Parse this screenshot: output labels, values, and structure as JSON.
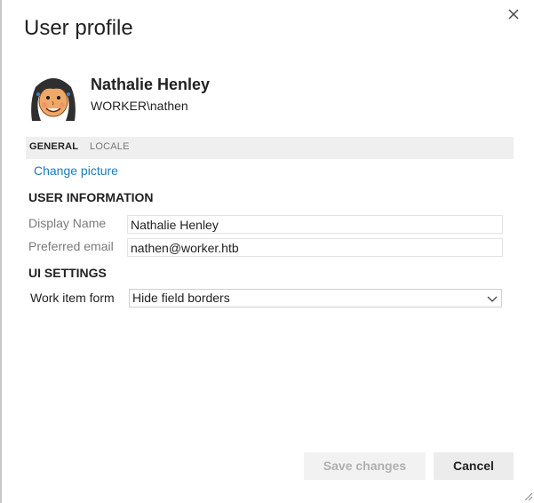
{
  "dialog": {
    "title": "User profile",
    "close_icon": "close-icon"
  },
  "user": {
    "name": "Nathalie Henley",
    "account": "WORKER\\nathen",
    "avatar_icon": "avatar-icon"
  },
  "tabs": [
    {
      "label": "GENERAL",
      "active": true
    },
    {
      "label": "LOCALE",
      "active": false
    }
  ],
  "change_picture_label": "Change picture",
  "user_information": {
    "heading": "USER INFORMATION",
    "display_name_label": "Display Name",
    "display_name_value": "Nathalie Henley",
    "email_label": "Preferred email",
    "email_value": "nathen@worker.htb"
  },
  "ui_settings": {
    "heading": "UI SETTINGS",
    "work_item_form_label": "Work item form",
    "work_item_form_value": "Hide field borders"
  },
  "buttons": {
    "save_label": "Save changes",
    "save_enabled": false,
    "cancel_label": "Cancel"
  },
  "colors": {
    "link": "#1a7dbd",
    "tab_bar_bg": "#efefef",
    "disabled_text": "#b0b0b0"
  }
}
